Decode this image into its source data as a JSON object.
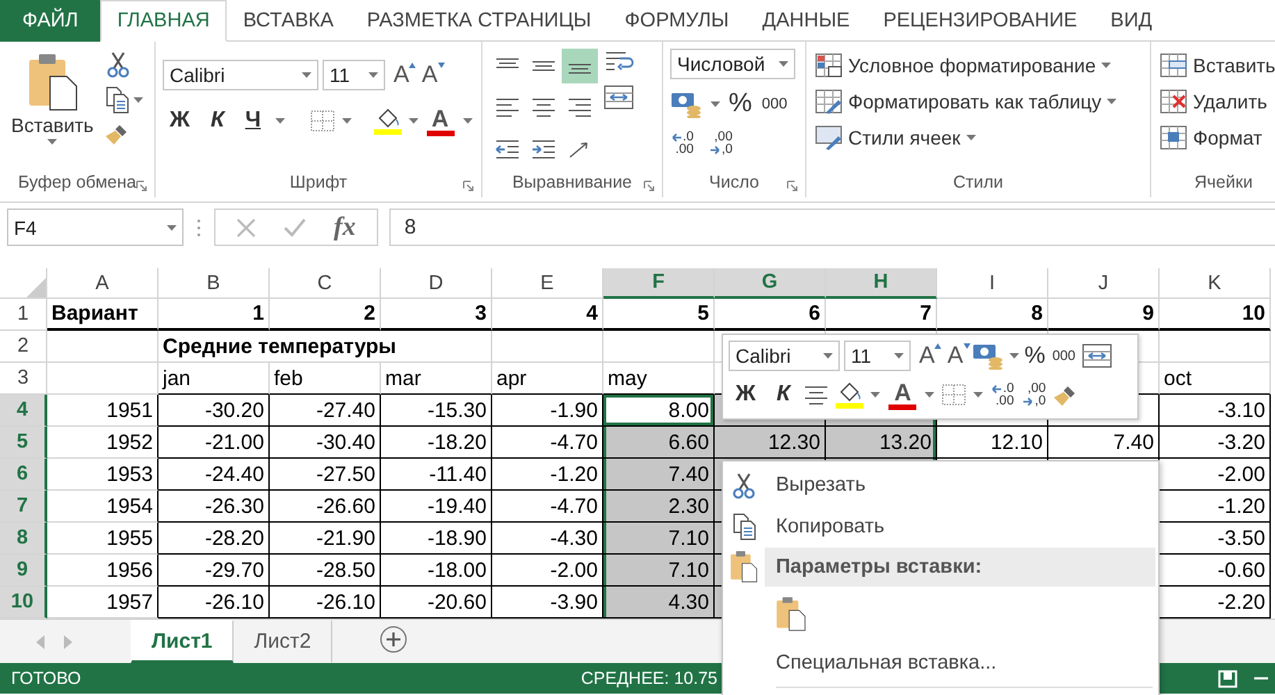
{
  "ribbon": {
    "tabs": [
      {
        "label": "ФАЙЛ",
        "kind": "file",
        "selected": false
      },
      {
        "label": "ГЛАВНАЯ",
        "kind": "tab",
        "selected": true
      },
      {
        "label": "ВСТАВКА",
        "kind": "tab",
        "selected": false
      },
      {
        "label": "РАЗМЕТКА СТРАНИЦЫ",
        "kind": "tab",
        "selected": false
      },
      {
        "label": "ФОРМУЛЫ",
        "kind": "tab",
        "selected": false
      },
      {
        "label": "ДАННЫЕ",
        "kind": "tab",
        "selected": false
      },
      {
        "label": "РЕЦЕНЗИРОВАНИЕ",
        "kind": "tab",
        "selected": false
      },
      {
        "label": "ВИД",
        "kind": "tab",
        "selected": false
      }
    ],
    "clipboard": {
      "title": "Буфер обмена",
      "paste_label": "Вставить"
    },
    "font": {
      "title": "Шрифт",
      "font": "Calibri",
      "size": "11",
      "grow_label": "A",
      "shrink_label": "A",
      "bold": "Ж",
      "italic": "К",
      "underline": "Ч",
      "font_color_label": "A"
    },
    "alignment": {
      "title": "Выравнивание",
      "buttons": [
        {
          "kind": "top",
          "selected": false
        },
        {
          "kind": "middle",
          "selected": false
        },
        {
          "kind": "bottom",
          "selected": true
        },
        {
          "kind": "left",
          "selected": false
        },
        {
          "kind": "center",
          "selected": false
        },
        {
          "kind": "right",
          "selected": false
        },
        {
          "kind": "outdent",
          "selected": false
        },
        {
          "kind": "indent",
          "selected": false
        },
        {
          "kind": "orientation",
          "selected": false
        }
      ]
    },
    "number": {
      "title": "Число",
      "format": "Числовой",
      "percent": "%",
      "thousands": "000",
      "decimal_buttons": [
        {
          "kind": "increase",
          "top": ".0",
          "bottom": ".00"
        },
        {
          "kind": "decrease",
          "top": ",00",
          "bottom": ",0"
        }
      ]
    },
    "styles": {
      "title": "Стили",
      "items": [
        {
          "kind": "conditional",
          "label": "Условное форматирование"
        },
        {
          "kind": "table",
          "label": "Форматировать как таблицу"
        },
        {
          "kind": "cell",
          "label": "Стили ячеек"
        }
      ]
    },
    "cells": {
      "title": "Ячейки",
      "items": [
        {
          "kind": "insert",
          "label": "Вставить"
        },
        {
          "kind": "delete",
          "label": "Удалить"
        },
        {
          "kind": "format",
          "label": "Формат"
        }
      ]
    }
  },
  "formula_bar": {
    "name_box": "F4",
    "function_label": "fx",
    "value": "8"
  },
  "sheet": {
    "columns": [
      {
        "label": "A",
        "selected": false
      },
      {
        "label": "B",
        "selected": false
      },
      {
        "label": "C",
        "selected": false
      },
      {
        "label": "D",
        "selected": false
      },
      {
        "label": "E",
        "selected": false
      },
      {
        "label": "F",
        "selected": true,
        "active": true
      },
      {
        "label": "G",
        "selected": true
      },
      {
        "label": "H",
        "selected": true
      },
      {
        "label": "I",
        "selected": false
      },
      {
        "label": "J",
        "selected": false
      },
      {
        "label": "K",
        "selected": false
      }
    ],
    "rows": [
      {
        "label": "1",
        "kind": "header",
        "selected": false,
        "cells": [
          "Вариант",
          "1",
          "2",
          "3",
          "4",
          "5",
          "6",
          "7",
          "8",
          "9",
          "10"
        ]
      },
      {
        "label": "2",
        "kind": "title",
        "selected": false,
        "cells": [
          null,
          "Средние температуры",
          null,
          null,
          null,
          null,
          null,
          null,
          null,
          null,
          null
        ]
      },
      {
        "label": "3",
        "kind": "months",
        "selected": false,
        "cells": [
          null,
          "jan",
          "feb",
          "mar",
          "apr",
          "may",
          null,
          null,
          null,
          null,
          "oct"
        ]
      },
      {
        "label": "4",
        "kind": "data",
        "selected": true,
        "active": true,
        "cells": [
          "1951",
          "-30.20",
          "-27.40",
          "-15.30",
          "-1.90",
          "8.00",
          null,
          null,
          null,
          null,
          "-3.10"
        ]
      },
      {
        "label": "5",
        "kind": "data",
        "selected": true,
        "cells": [
          "1952",
          "-21.00",
          "-30.40",
          "-18.20",
          "-4.70",
          "6.60",
          "12.30",
          "13.20",
          "12.10",
          "7.40",
          "-3.20"
        ]
      },
      {
        "label": "6",
        "kind": "data",
        "selected": true,
        "cells": [
          "1953",
          "-24.40",
          "-27.50",
          "-11.40",
          "-1.20",
          "7.40",
          null,
          null,
          null,
          null,
          "-2.00"
        ]
      },
      {
        "label": "7",
        "kind": "data",
        "selected": true,
        "cells": [
          "1954",
          "-26.30",
          "-26.60",
          "-19.40",
          "-4.70",
          "2.30",
          null,
          null,
          null,
          null,
          "-1.20"
        ]
      },
      {
        "label": "8",
        "kind": "data",
        "selected": true,
        "cells": [
          "1955",
          "-28.20",
          "-21.90",
          "-18.90",
          "-4.30",
          "7.10",
          null,
          null,
          null,
          null,
          "-3.50"
        ]
      },
      {
        "label": "9",
        "kind": "data",
        "selected": true,
        "cells": [
          "1956",
          "-29.70",
          "-28.50",
          "-18.00",
          "-2.00",
          "7.10",
          null,
          null,
          null,
          null,
          "-0.60"
        ]
      },
      {
        "label": "10",
        "kind": "data",
        "selected": true,
        "cells": [
          "1957",
          "-26.10",
          "-26.10",
          "-20.60",
          "-3.90",
          "4.30",
          null,
          null,
          null,
          null,
          "-2.20"
        ]
      }
    ]
  },
  "mini_toolbar": {
    "font": "Calibri",
    "size": "11",
    "grow_label": "A",
    "shrink_label": "A",
    "percent": "%",
    "thousands": "000",
    "bold": "Ж",
    "italic": "К",
    "font_color_label": "A",
    "decimal_buttons": [
      {
        "kind": "increase",
        "top": ".0",
        "bottom": ".00"
      },
      {
        "kind": "decrease",
        "top": ",00",
        "bottom": ",0"
      }
    ]
  },
  "context_menu": [
    {
      "kind": "cut",
      "label": "Вырезать"
    },
    {
      "kind": "copy",
      "label": "Копировать"
    },
    {
      "kind": "section",
      "label": "Параметры вставки:"
    },
    {
      "kind": "paste_options"
    },
    {
      "kind": "item",
      "label": "Специальная вставка..."
    }
  ],
  "sheet_tabs": [
    {
      "label": "Лист1",
      "selected": true
    },
    {
      "label": "Лист2",
      "selected": false
    }
  ],
  "status_bar": {
    "status": "ГОТОВО",
    "summary": "СРЕДНЕЕ: 10.75"
  }
}
